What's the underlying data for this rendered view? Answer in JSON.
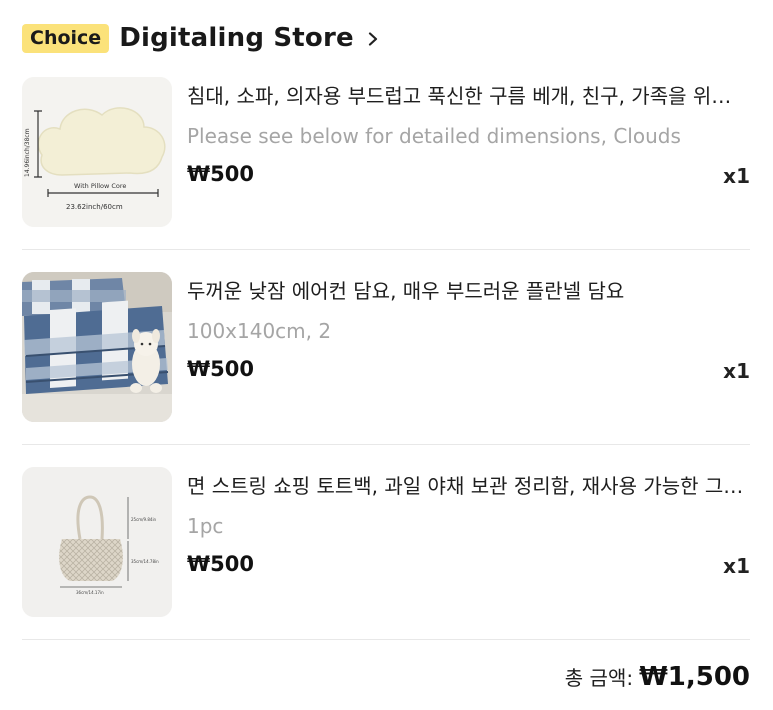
{
  "store": {
    "badge": "Choice",
    "name": "Digitaling Store"
  },
  "items": [
    {
      "title": "침대, 소파, 의자용 부드럽고 푹신한 구름 베개, 친구, 가족을 위한 선물",
      "variant": "Please see below for detailed dimensions, Clouds",
      "price": "₩500",
      "qty": "x1",
      "image_text": {
        "height": "14.96inch/38cm",
        "core": "With Pillow Core",
        "width": "23.62inch/60cm"
      }
    },
    {
      "title": "두꺼운 낮잠 에어컨 담요, 매우 부드러운 플란넬 담요",
      "variant": "100x140cm, 2",
      "price": "₩500",
      "qty": "x1"
    },
    {
      "title": "면 스트링 쇼핑 토트백, 과일 야채 보관 정리함, 재사용 가능한 그물 가방",
      "variant": "1pc",
      "price": "₩500",
      "qty": "x1",
      "image_text": {
        "handle": "25cm/9.84in",
        "body": "35cm/14.78in",
        "width": "36cm/14.17in"
      }
    }
  ],
  "total": {
    "label": "총 금액:",
    "value": "₩1,500"
  }
}
